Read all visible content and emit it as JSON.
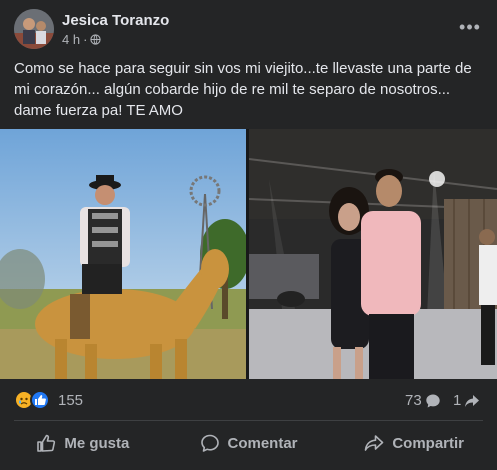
{
  "post": {
    "author": "Jesica Toranzo",
    "time": "4 h",
    "privacy_icon": "globe-icon",
    "more_icon": "more-options-icon",
    "text": "Como se hace para seguir sin vos mi viejito...te llevaste una parte de mi corazón... algún cobarde hijo de re mil te separo de nosotros... dame fuerza pa! TE AMO"
  },
  "photos": [
    {
      "description_icon": "photo-man-on-horse"
    },
    {
      "description_icon": "photo-couple-at-party"
    }
  ],
  "stats": {
    "reaction_icons": [
      "sad-reaction-icon",
      "like-reaction-icon"
    ],
    "reaction_count": "155",
    "comment_count": "73",
    "share_count": "1"
  },
  "actions": {
    "like": "Me gusta",
    "comment": "Comentar",
    "share": "Compartir"
  },
  "colors": {
    "background": "#242526",
    "text": "#e4e6eb",
    "secondary": "#b0b3b8",
    "like_blue": "#2078f4",
    "sad_yellow": "#f7b125"
  }
}
